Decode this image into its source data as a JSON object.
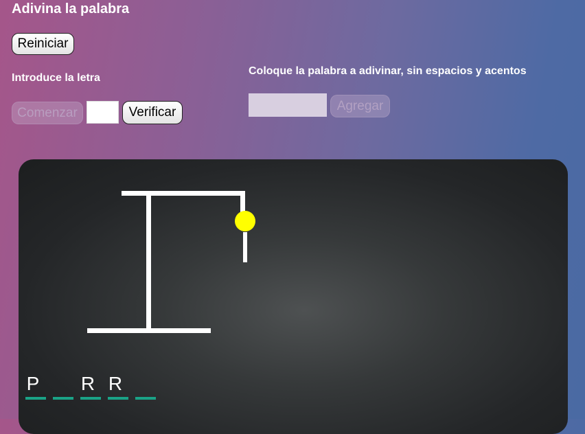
{
  "title": "Adivina la palabra",
  "buttons": {
    "reset": "Reiniciar",
    "start": "Comenzar",
    "verify": "Verificar",
    "add": "Agregar"
  },
  "labels": {
    "enter_letter": "Introduce la letra",
    "enter_word": "Coloque la palabra a adivinar, sin espacios y acentos"
  },
  "inputs": {
    "letter_value": "",
    "word_value": ""
  },
  "word_slots": [
    {
      "letter": "P"
    },
    {
      "letter": ""
    },
    {
      "letter": "R"
    },
    {
      "letter": "R"
    },
    {
      "letter": ""
    }
  ],
  "colors": {
    "head": "#ffff00",
    "lines": "#ffffff",
    "slot_underline": "#1aa387"
  }
}
